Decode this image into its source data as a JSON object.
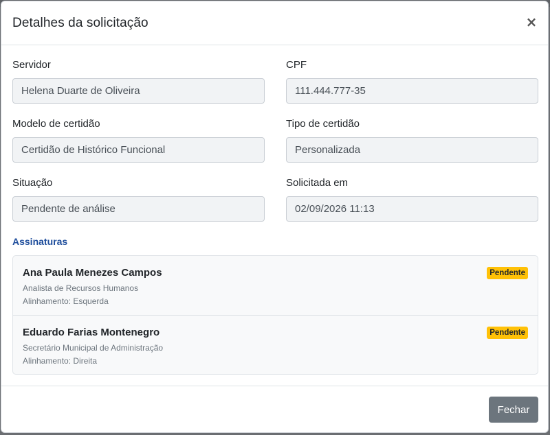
{
  "modal": {
    "title": "Detalhes da solicitação",
    "close_symbol": "×"
  },
  "fields": {
    "servidor": {
      "label": "Servidor",
      "value": "Helena Duarte de Oliveira"
    },
    "cpf": {
      "label": "CPF",
      "value": "111.444.777-35"
    },
    "modelo": {
      "label": "Modelo de certidão",
      "value": "Certidão de Histórico Funcional"
    },
    "tipo": {
      "label": "Tipo de certidão",
      "value": "Personalizada"
    },
    "situacao": {
      "label": "Situação",
      "value": "Pendente de análise"
    },
    "solicitada": {
      "label": "Solicitada em",
      "value": "02/09/2026 11:13"
    }
  },
  "signatures": {
    "title": "Assinaturas",
    "items": [
      {
        "name": "Ana Paula Menezes Campos",
        "role": "Analista de Recursos Humanos",
        "alignment": "Alinhamento: Esquerda",
        "status": "Pendente"
      },
      {
        "name": "Eduardo Farias Montenegro",
        "role": "Secretário Municipal de Administração",
        "alignment": "Alinhamento: Direita",
        "status": "Pendente"
      }
    ]
  },
  "footer": {
    "close_label": "Fechar"
  },
  "colors": {
    "accent_title": "#1f4e9c",
    "badge_pending": "#ffc107",
    "button_secondary": "#6c757d"
  }
}
